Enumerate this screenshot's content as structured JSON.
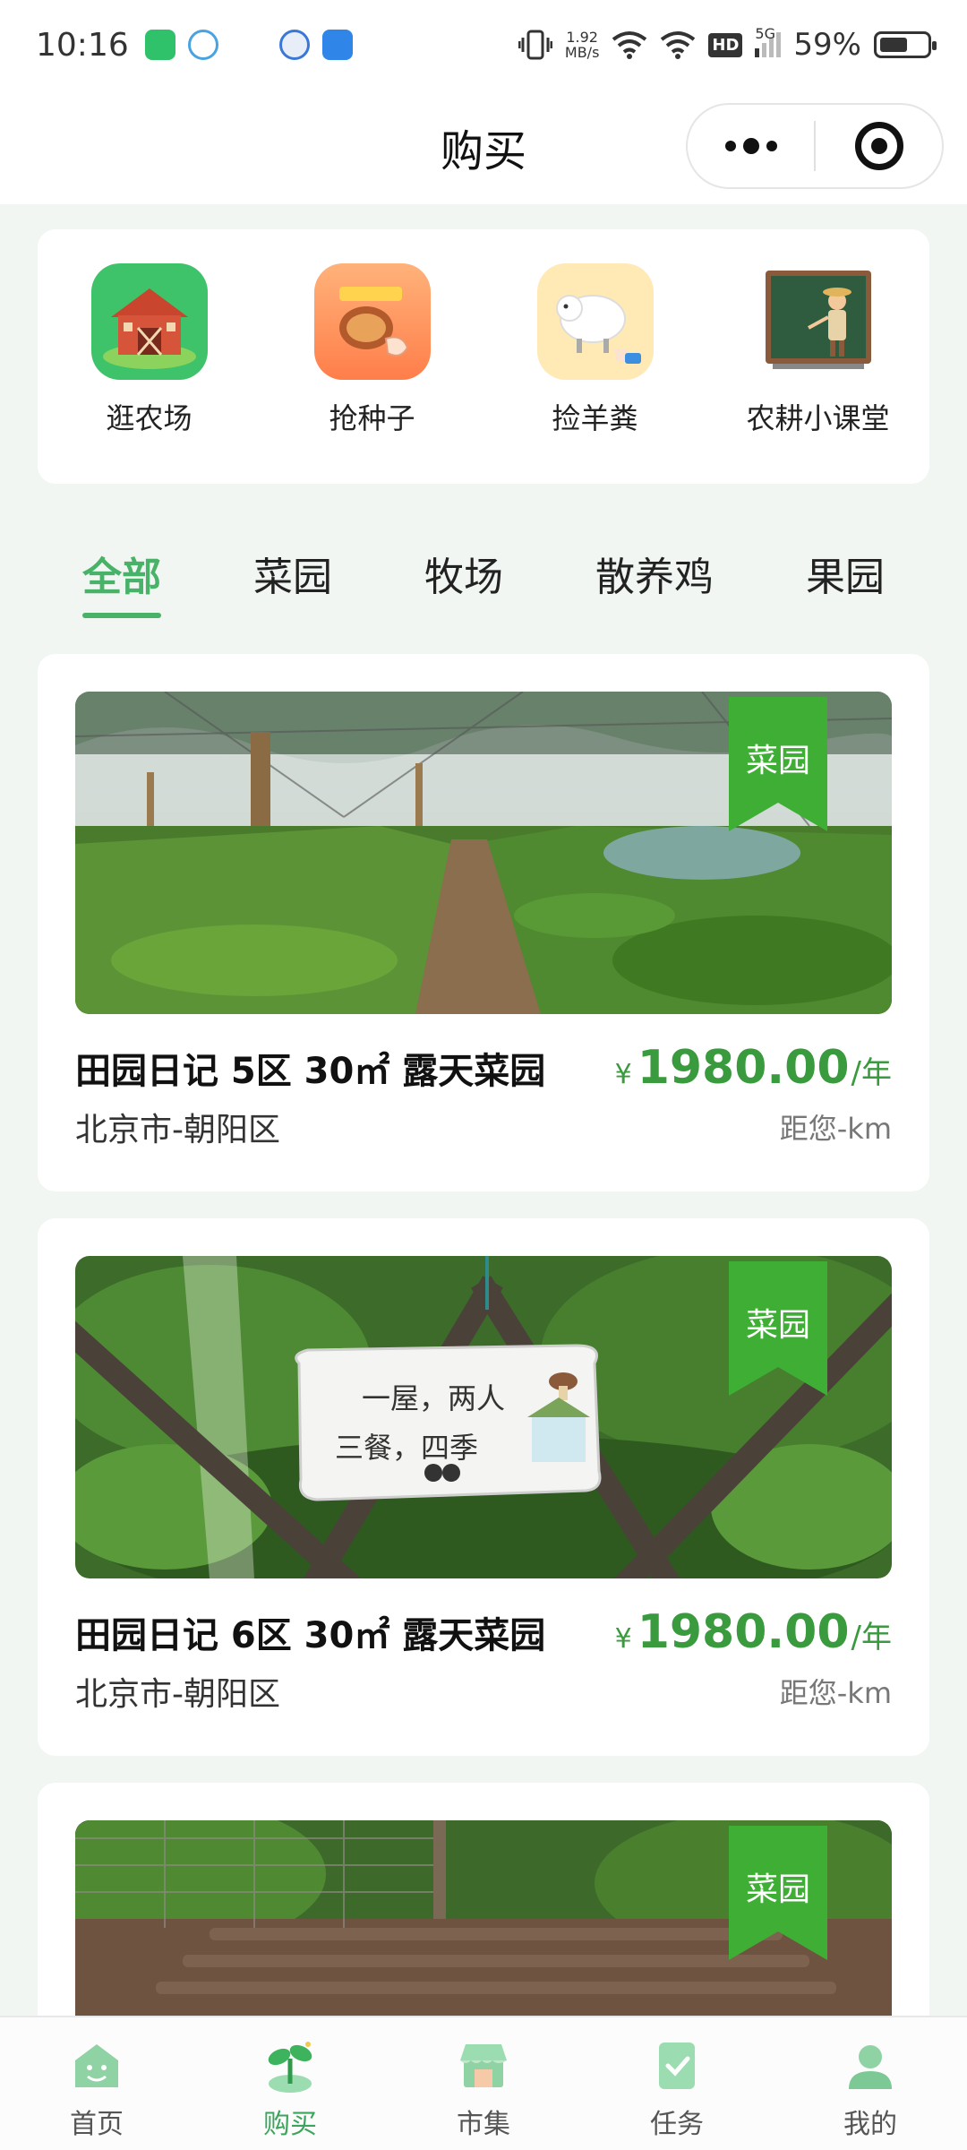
{
  "status_bar": {
    "time": "10:16",
    "net_speed_value": "1.92",
    "net_speed_unit": "MB/s",
    "network_badge": "HD",
    "signal_label": "5G",
    "battery": "59%"
  },
  "nav": {
    "title": "购买"
  },
  "quick_menu": [
    {
      "label": "逛农场",
      "icon": "barn-icon"
    },
    {
      "label": "抢种子",
      "icon": "seed-grab-icon"
    },
    {
      "label": "捡羊粪",
      "icon": "sheep-icon"
    },
    {
      "label": "农耕小课堂",
      "icon": "classroom-icon"
    }
  ],
  "tabs": [
    {
      "label": "全部",
      "active": true
    },
    {
      "label": "菜园",
      "active": false
    },
    {
      "label": "牧场",
      "active": false
    },
    {
      "label": "散养鸡",
      "active": false
    },
    {
      "label": "果园",
      "active": false
    }
  ],
  "listings": [
    {
      "tag": "菜园",
      "title": "田园日记 5区 30㎡ 露天菜园",
      "currency": "¥",
      "price": "1980.00",
      "unit": "/年",
      "location": "北京市-朝阳区",
      "distance": "距您-km"
    },
    {
      "tag": "菜园",
      "title": "田园日记 6区 30㎡ 露天菜园",
      "currency": "¥",
      "price": "1980.00",
      "unit": "/年",
      "location": "北京市-朝阳区",
      "distance": "距您-km",
      "sign_text_line1": "一屋，两人",
      "sign_text_line2": "三餐，四季"
    },
    {
      "tag": "菜园"
    }
  ],
  "bottom_nav": [
    {
      "label": "首页",
      "icon": "home-face-icon",
      "active": false
    },
    {
      "label": "购买",
      "icon": "sprout-icon",
      "active": true
    },
    {
      "label": "市集",
      "icon": "market-stall-icon",
      "active": false
    },
    {
      "label": "任务",
      "icon": "task-check-icon",
      "active": false
    },
    {
      "label": "我的",
      "icon": "profile-icon",
      "active": false
    }
  ],
  "colors": {
    "accent": "#47b268",
    "price": "#3a9a3e",
    "ribbon": "#3fae35",
    "background": "#f1f6f3"
  }
}
